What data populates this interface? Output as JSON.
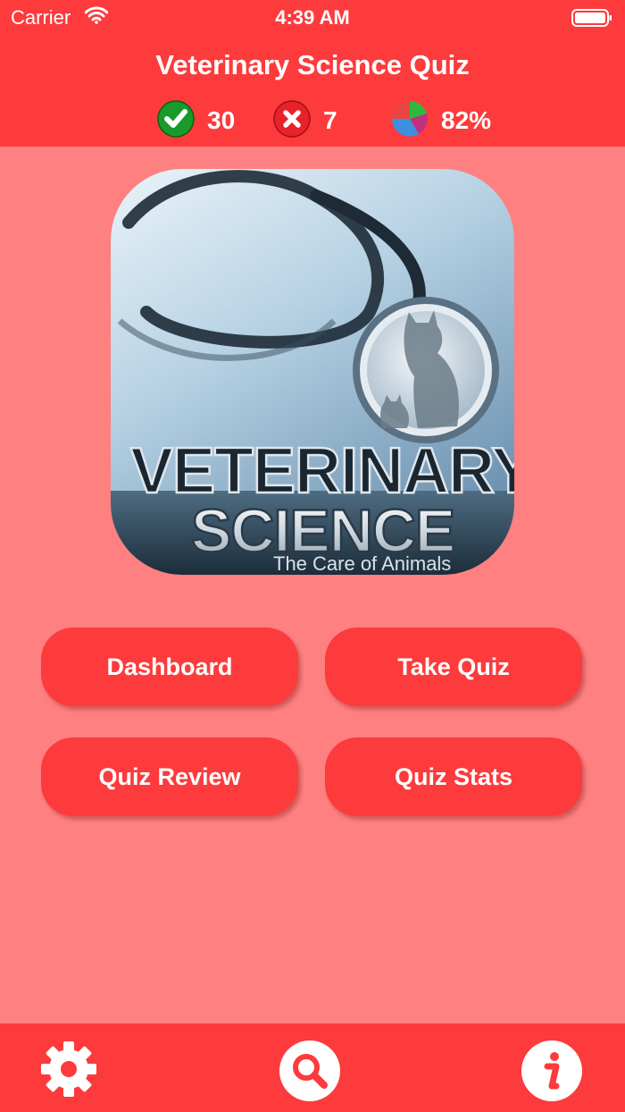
{
  "status_bar": {
    "carrier": "Carrier",
    "time": "4:39 AM"
  },
  "header": {
    "title": "Veterinary Science Quiz"
  },
  "stats": {
    "correct_count": "30",
    "wrong_count": "7",
    "score_percent": "82%"
  },
  "logo": {
    "line1": "VETERINARY",
    "line2": "SCIENCE",
    "tagline": "The Care of Animals"
  },
  "menu": {
    "dashboard": "Dashboard",
    "take_quiz": "Take Quiz",
    "quiz_review": "Quiz Review",
    "quiz_stats": "Quiz Stats"
  },
  "toolbar": {
    "settings_icon": "gear-icon",
    "search_icon": "search-icon",
    "info_icon": "info-icon"
  },
  "colors": {
    "bar_red": "#fd3a3c",
    "background": "#ff8080",
    "correct_green": "#1a9a2a",
    "wrong_red": "#e8222a"
  }
}
